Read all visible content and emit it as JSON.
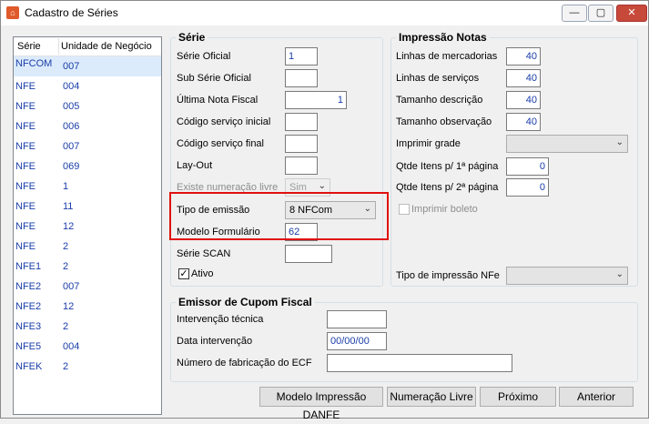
{
  "window": {
    "title": "Cadastro de Séries",
    "app_icon": "app-logo-icon",
    "controls": {
      "minimize": "—",
      "maximize": "▢",
      "close": "✕"
    }
  },
  "series_list": {
    "headers": [
      "Série",
      "Unidade de Negócio"
    ],
    "rows": [
      {
        "serie": "NFCOM",
        "unidade": "007"
      },
      {
        "serie": "NFE",
        "unidade": "004"
      },
      {
        "serie": "NFE",
        "unidade": "005"
      },
      {
        "serie": "NFE",
        "unidade": "006"
      },
      {
        "serie": "NFE",
        "unidade": "007"
      },
      {
        "serie": "NFE",
        "unidade": "069"
      },
      {
        "serie": "NFE",
        "unidade": "1"
      },
      {
        "serie": "NFE",
        "unidade": "11"
      },
      {
        "serie": "NFE",
        "unidade": "12"
      },
      {
        "serie": "NFE",
        "unidade": "2"
      },
      {
        "serie": "NFE1",
        "unidade": "2"
      },
      {
        "serie": "NFE2",
        "unidade": "007"
      },
      {
        "serie": "NFE2",
        "unidade": "12"
      },
      {
        "serie": "NFE3",
        "unidade": "2"
      },
      {
        "serie": "NFE5",
        "unidade": "004"
      },
      {
        "serie": "NFEK",
        "unidade": "2"
      }
    ]
  },
  "serie_group": {
    "title": "Série",
    "serie_oficial": {
      "label": "Série Oficial",
      "value": "1"
    },
    "sub_serie_oficial": {
      "label": "Sub Série Oficial",
      "value": ""
    },
    "ultima_nota": {
      "label": "Última Nota Fiscal",
      "value": "1"
    },
    "codigo_servico_inicial": {
      "label": "Código serviço inicial",
      "value": ""
    },
    "codigo_servico_final": {
      "label": "Código serviço final",
      "value": ""
    },
    "layout": {
      "label": "Lay-Out",
      "value": ""
    },
    "existe_numeracao_livre": {
      "label": "Existe numeração livre",
      "value": "Sim"
    },
    "tipo_emissao": {
      "label": "Tipo de emissão",
      "value": "8 NFCom"
    },
    "modelo_formulario": {
      "label": "Modelo Formulário",
      "value": "62"
    },
    "serie_scan": {
      "label": "Série SCAN",
      "value": ""
    },
    "ativo": {
      "label": "Ativo",
      "checked": true
    }
  },
  "impressao_group": {
    "title": "Impressão Notas",
    "linhas_mercadorias": {
      "label": "Linhas de mercadorias",
      "value": "40"
    },
    "linhas_servicos": {
      "label": "Linhas de serviços",
      "value": "40"
    },
    "tamanho_descricao": {
      "label": "Tamanho descrição",
      "value": "40"
    },
    "tamanho_observacao": {
      "label": "Tamanho observação",
      "value": "40"
    },
    "imprimir_grade": {
      "label": "Imprimir grade",
      "value": ""
    },
    "qtde_itens_1": {
      "label": "Qtde Itens p/ 1ª página",
      "value": "0"
    },
    "qtde_itens_2": {
      "label": "Qtde Itens p/ 2ª página",
      "value": "0"
    },
    "imprimir_boleto": {
      "label": "Imprimir boleto",
      "checked": false
    },
    "tipo_impressao_nfe": {
      "label": "Tipo de impressão NFe",
      "value": ""
    }
  },
  "cupom_group": {
    "title": "Emissor de Cupom Fiscal",
    "intervencao_tecnica": {
      "label": "Intervenção técnica",
      "value": ""
    },
    "data_intervencao": {
      "label": "Data intervenção",
      "value": "00/00/00"
    },
    "numero_fabricacao": {
      "label": "Número de fabricação do ECF",
      "value": ""
    }
  },
  "buttons": {
    "modelo_impressao": "Modelo Impressão DANFE",
    "numeracao_livre": "Numeração Livre",
    "proximo": "Próximo",
    "anterior": "Anterior"
  },
  "highlight_color": "#e01010"
}
